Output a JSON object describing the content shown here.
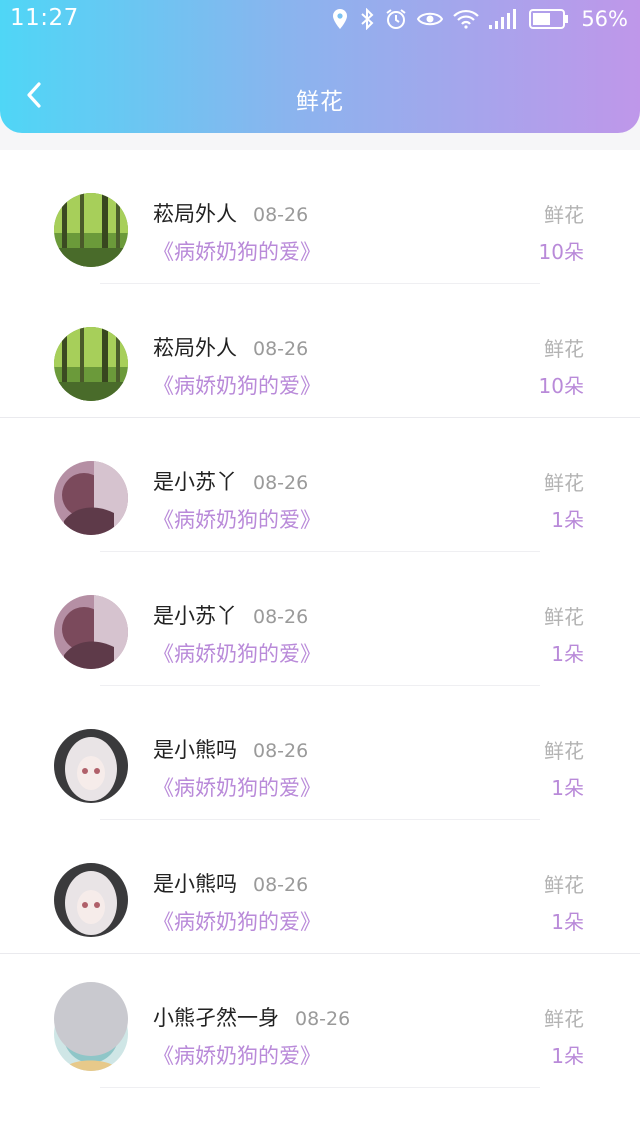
{
  "status_bar": {
    "time": "11:27",
    "battery": "56%",
    "icons": [
      "location-icon",
      "bluetooth-icon",
      "alarm-icon",
      "eye-icon",
      "wifi-icon",
      "signal-icon",
      "battery-icon"
    ]
  },
  "header": {
    "title": "鲜花",
    "back_icon": "chevron-left-icon",
    "gradient": [
      "#4fd6f6",
      "#8ab4ee",
      "#bf97ea"
    ]
  },
  "records": [
    {
      "user": "菘局外人",
      "date": "08-26",
      "book": "《病娇奶狗的爱》",
      "gift_label": "鲜花",
      "gift_count": "10朵",
      "avatar": "forest-avatar"
    },
    {
      "user": "菘局外人",
      "date": "08-26",
      "book": "《病娇奶狗的爱》",
      "gift_label": "鲜花",
      "gift_count": "10朵",
      "avatar": "forest-avatar"
    },
    {
      "user": "是小苏丫",
      "date": "08-26",
      "book": "《病娇奶狗的爱》",
      "gift_label": "鲜花",
      "gift_count": "1朵",
      "avatar": "anime-girl-pink-avatar"
    },
    {
      "user": "是小苏丫",
      "date": "08-26",
      "book": "《病娇奶狗的爱》",
      "gift_label": "鲜花",
      "gift_count": "1朵",
      "avatar": "anime-girl-pink-avatar"
    },
    {
      "user": "是小熊吗",
      "date": "08-26",
      "book": "《病娇奶狗的爱》",
      "gift_label": "鲜花",
      "gift_count": "1朵",
      "avatar": "anime-girl-white-avatar"
    },
    {
      "user": "是小熊吗",
      "date": "08-26",
      "book": "《病娇奶狗的爱》",
      "gift_label": "鲜花",
      "gift_count": "1朵",
      "avatar": "anime-girl-white-avatar"
    },
    {
      "user": "小熊孑然一身",
      "date": "08-26",
      "book": "《病娇奶狗的爱》",
      "gift_label": "鲜花",
      "gift_count": "1朵",
      "avatar": "anime-girl-teal-avatar"
    }
  ],
  "colors": {
    "accent": "#b98ad9",
    "muted": "#b3b3b3",
    "text": "#222222"
  }
}
